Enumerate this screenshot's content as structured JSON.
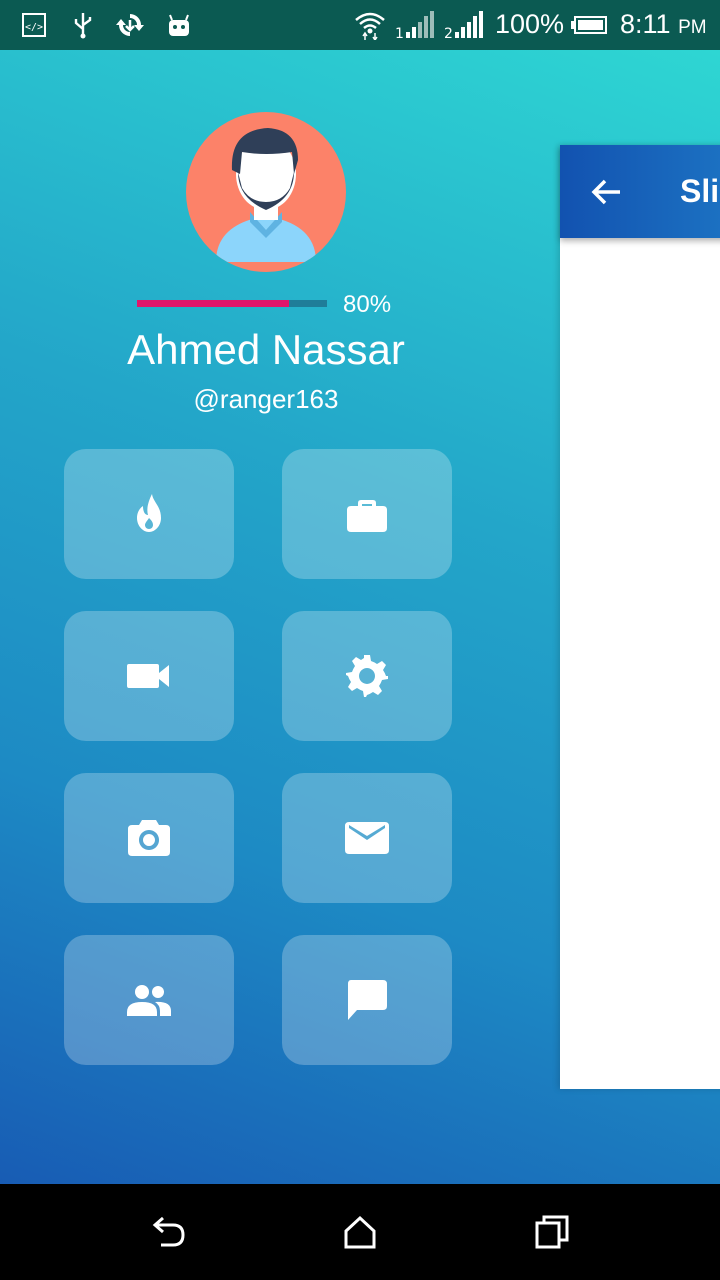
{
  "status_bar": {
    "battery": "100%",
    "time": "8:11",
    "time_suffix": "PM",
    "sim1": "1",
    "sim2": "2"
  },
  "profile": {
    "name": "Ahmed Nassar",
    "handle": "@ranger163",
    "progress_percent": 80,
    "progress_label": "80%"
  },
  "colors": {
    "progress_fill": "#e0166a",
    "avatar_bg": "#fc8269",
    "appbar": "#1252b0"
  },
  "menu_tiles": [
    {
      "icon": "fire-icon"
    },
    {
      "icon": "briefcase-icon"
    },
    {
      "icon": "videocam-icon"
    },
    {
      "icon": "settings-icon"
    },
    {
      "icon": "camera-icon"
    },
    {
      "icon": "mail-icon"
    },
    {
      "icon": "people-icon"
    },
    {
      "icon": "chat-icon"
    }
  ],
  "content": {
    "appbar_title": "Slid"
  }
}
